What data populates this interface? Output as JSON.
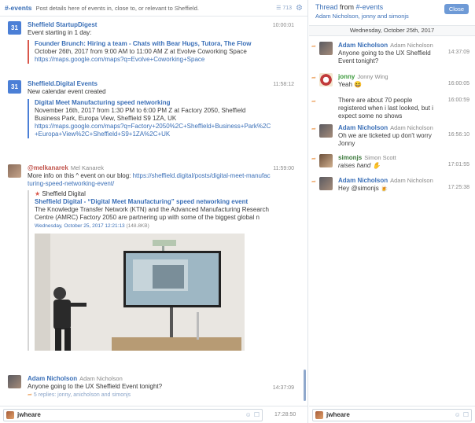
{
  "left_header": {
    "channel": "#-events",
    "topic": "Post details here of events in, close to, or relevant to Sheffield.",
    "count": "713"
  },
  "messages": [
    {
      "name": "Sheffield StartupDigest",
      "time": "10:00:01",
      "text": "Event starting in 1 day:",
      "event_title": "Founder Brunch: Hiring a team - Chats with Bear Hugs, Tutora, The Flow",
      "event_details": "October 26th, 2017 from 9:00 AM to 11:00 AM Z at Evolve Coworking Space",
      "event_link": "https://maps.google.com/maps?q=Evolve+Coworking+Space"
    },
    {
      "name": "Sheffield.Digital Events",
      "time": "11:58:12",
      "text": "New calendar event created",
      "event_title": "Digital Meet Manufacturing speed networking",
      "event_details": "November 16th, 2017 from 1:30 PM to 6:00 PM Z at Factory 2050, Sheffield Business Park, Europa View, Sheffield S9 1ZA, UK",
      "event_link": "https://maps.google.com/maps?q=Factory+2050%2C+Sheffield+Business+Park%2C+Europa+View%2C+Sheffield+S9+1ZA%2C+UK"
    },
    {
      "name": "@melkanarek",
      "uname": "Mel Kanarek",
      "time": "11:59:00",
      "text": "More info on this ^ event on our blog: ",
      "link": "https://sheffield.digital/posts/digital-meet-manufacturing-speed-networking-event/",
      "preview_site": "Sheffield Digital",
      "preview_title": "Sheffield Digital - “Digital Meet Manufacturing” speed networking event",
      "preview_desc": "The Knowledge Transfer Network (KTN) and the Advanced Manufacturing Research Centre (AMRC) Factory 2050 are partnering up with some of the biggest global n",
      "preview_date": "Wednesday, October 25, 2017 12:21:13",
      "preview_size": "(148.8KB)"
    },
    {
      "name": "Adam Nicholson",
      "uname": "Adam Nicholson",
      "time": "14:37:09",
      "text": "Anyone going to the UX Sheffield Event tonight?",
      "replies": "5 replies: jonny, anicholson and simonjs"
    }
  ],
  "left_input": {
    "user": "jwheare",
    "time": "17:28:50"
  },
  "thread": {
    "title_prefix": "Thread",
    "title_from": "from",
    "channel": "#-events",
    "participants": "Adam Nicholson, jonny and simonjs",
    "close": "Close",
    "date": "Wednesday, October 25th, 2017",
    "messages": [
      {
        "name": "Adam Nicholson",
        "uname": "Adam Nicholson",
        "text": "Anyone going to the UX Sheffield Event tonight?",
        "time": "14:37:09"
      },
      {
        "name": "jonny",
        "uname": "Jonny Wing",
        "text": "Yeah 😆",
        "time": "16:00:05"
      },
      {
        "name": "",
        "uname": "",
        "text": "There are about 70 people registered when i last looked, but i expect some no shows",
        "time": "16:00:59"
      },
      {
        "name": "Adam Nicholson",
        "uname": "Adam Nicholson",
        "text": "Oh we are ticketed up don't worry Jonny",
        "time": "16:56:10"
      },
      {
        "name": "simonjs",
        "uname": "Simon Scott",
        "text": "raises hand ✋",
        "time": "17:01:55"
      },
      {
        "name": "Adam Nicholson",
        "uname": "Adam Nicholson",
        "text": "Hey @simonjs 🍺",
        "time": "17:25:38"
      }
    ]
  },
  "right_input": {
    "user": "jwheare"
  }
}
